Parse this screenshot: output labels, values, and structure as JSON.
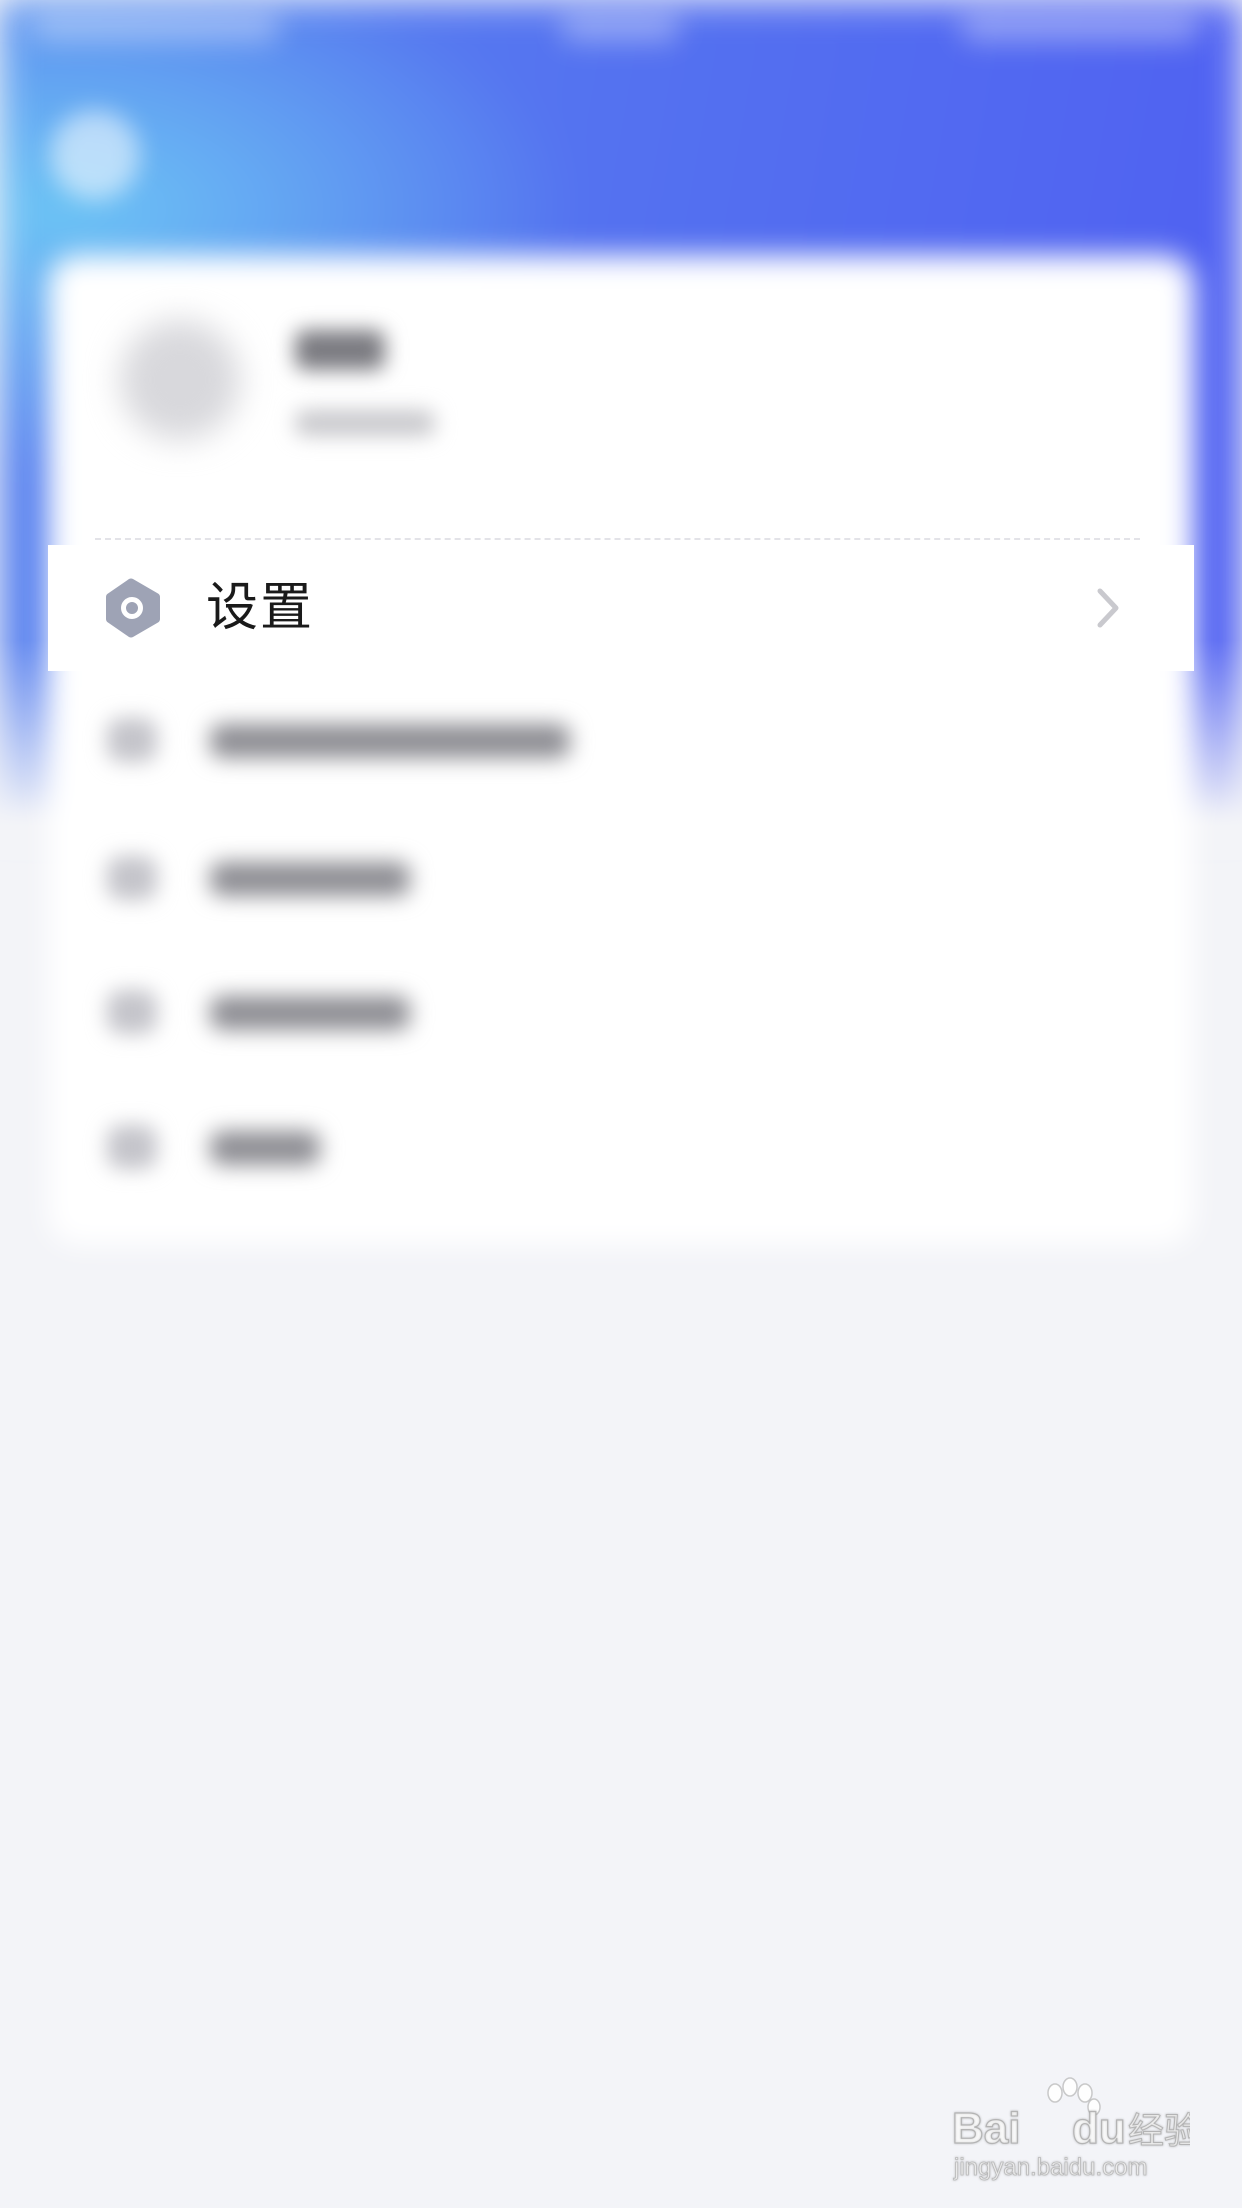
{
  "settings_row": {
    "label": "设置",
    "icon": "settings-hexagon-icon",
    "chevron_icon": "chevron-right-icon"
  },
  "watermark": {
    "logo_text": "Bai du 经验",
    "url": "jingyan.baidu.com"
  },
  "colors": {
    "header_blue": "#4f5ff2",
    "header_light_blue": "#6ec8f5",
    "background": "#f3f4f8",
    "icon_gray": "#9ea3b5",
    "chevron_gray": "#c9c9ce",
    "text": "#1a1a1a"
  }
}
